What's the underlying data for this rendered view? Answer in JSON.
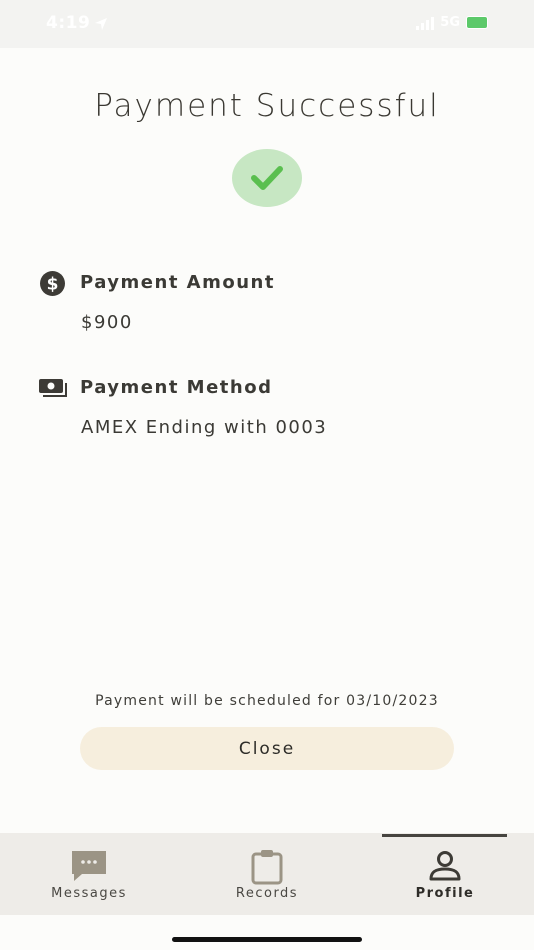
{
  "status_bar": {
    "time": "4:19",
    "network": "5G"
  },
  "screen": {
    "title": "Payment Successful",
    "amount": {
      "heading": "Payment Amount",
      "value": "$900",
      "icon": "dollar-circle-icon"
    },
    "method": {
      "heading": "Payment Method",
      "value": "AMEX Ending with 0003",
      "icon": "cash-icon"
    },
    "schedule_note": "Payment will be scheduled for 03/10/2023",
    "close_label": "Close"
  },
  "tab_bar": {
    "tabs": [
      {
        "label": "Messages",
        "icon": "chat-bubble-icon"
      },
      {
        "label": "Records",
        "icon": "clipboard-icon"
      },
      {
        "label": "Profile",
        "icon": "person-icon",
        "active": true
      }
    ]
  },
  "colors": {
    "accent_success": "#5abf4f",
    "success_badge": "#c7e7c3",
    "button_bg": "#f6eedd",
    "tab_bar_bg": "#eeece8"
  }
}
